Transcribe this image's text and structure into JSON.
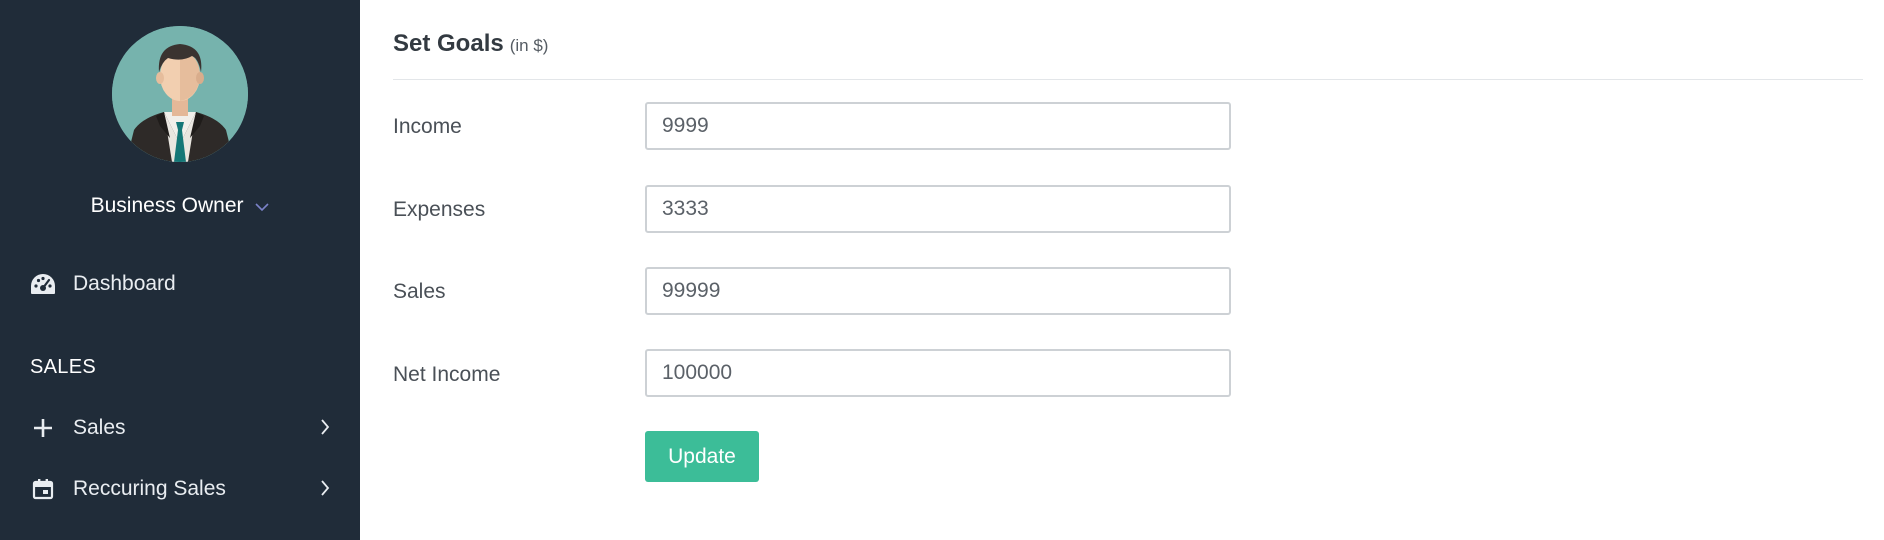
{
  "sidebar": {
    "user": {
      "name": "Business Owner",
      "avatar_icon": "business-man-avatar"
    },
    "items": [
      {
        "label": "Dashboard",
        "icon": "dashboard-gauge-icon"
      }
    ],
    "sections": [
      {
        "title": "SALES",
        "items": [
          {
            "label": "Sales",
            "icon": "plus-icon"
          },
          {
            "label": "Reccuring Sales",
            "icon": "calendar-icon"
          }
        ]
      }
    ]
  },
  "main": {
    "title": "Set Goals",
    "title_unit": "(in $)",
    "fields": [
      {
        "label": "Income",
        "value": "9999"
      },
      {
        "label": "Expenses",
        "value": "3333"
      },
      {
        "label": "Sales",
        "value": "99999"
      },
      {
        "label": "Net Income",
        "value": "100000"
      }
    ],
    "update_label": "Update"
  },
  "colors": {
    "sidebar_bg": "#202c39",
    "accent_button": "#3cbd98",
    "user_chevron": "#7b83c9",
    "avatar_bg": "#76b3ad"
  }
}
